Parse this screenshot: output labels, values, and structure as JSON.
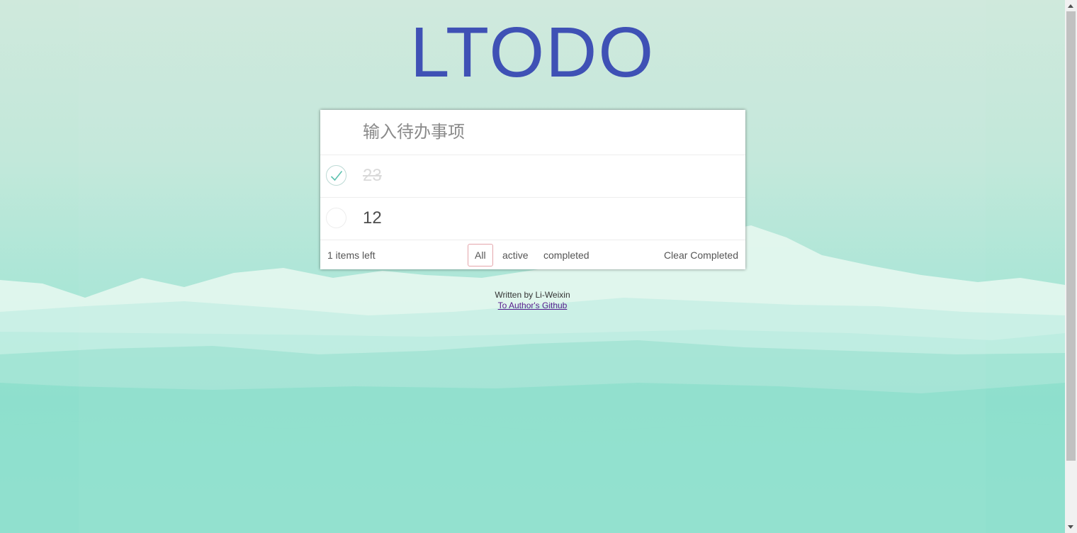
{
  "app": {
    "title": "LTODO"
  },
  "input": {
    "placeholder": "输入待办事项",
    "value": ""
  },
  "todos": [
    {
      "text": "23",
      "completed": true
    },
    {
      "text": "12",
      "completed": false
    }
  ],
  "footer": {
    "items_left": "1 items left",
    "filters": [
      "All",
      "active",
      "completed"
    ],
    "selected_filter": "All",
    "clear_label": "Clear Completed"
  },
  "credits": {
    "written_by": "Written by Li-Weixin",
    "link_text": "To Author's Github"
  },
  "colors": {
    "title": "#3f51b5",
    "check": "#5dc2af",
    "selected_filter_border": "#e4a5aa",
    "background_top": "#cfe9dc",
    "background_bottom": "#9ae6d6"
  },
  "icons": {
    "toggle_done": "check-icon",
    "toggle_open": "empty-circle-icon"
  }
}
